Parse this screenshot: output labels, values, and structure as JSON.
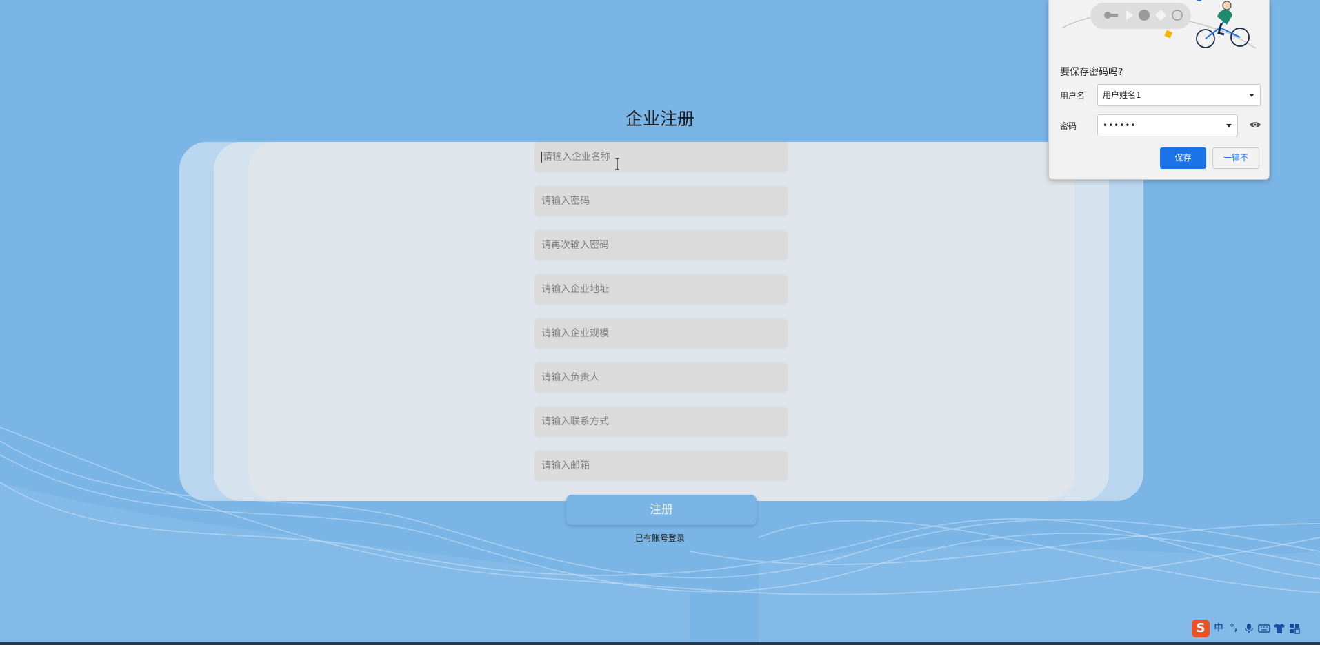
{
  "page": {
    "title": "企业注册",
    "form": {
      "company_name_placeholder": "请输入企业名称",
      "password_placeholder": "请输入密码",
      "confirm_password_placeholder": "请再次输入密码",
      "address_placeholder": "请输入企业地址",
      "scale_placeholder": "请输入企业规模",
      "manager_placeholder": "请输入负责人",
      "contact_placeholder": "请输入联系方式",
      "email_placeholder": "请输入邮箱"
    },
    "register_label": "注册",
    "login_link": "已有账号登录"
  },
  "password_popup": {
    "question": "要保存密码吗?",
    "username_label": "用户名",
    "username_value": "用户姓名1",
    "password_label": "密码",
    "password_value": "••••••",
    "save_label": "保存",
    "never_label": "一律不"
  },
  "ime": {
    "logo": "S",
    "mode": "中",
    "punct": "°,"
  },
  "colors": {
    "background": "#7ab5e6",
    "field": "#dcdbdc",
    "save_button": "#1a73e8"
  }
}
